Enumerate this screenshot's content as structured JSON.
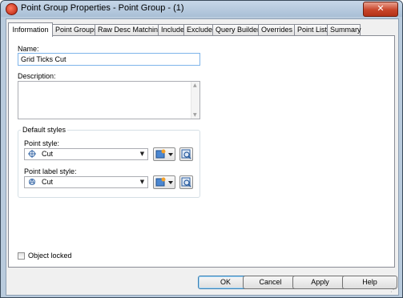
{
  "window": {
    "title": "Point Group Properties - Point Group - (1)",
    "close_glyph": "✕"
  },
  "tabs": [
    {
      "label": "Information",
      "active": true
    },
    {
      "label": "Point Groups"
    },
    {
      "label": "Raw Desc Matching"
    },
    {
      "label": "Include"
    },
    {
      "label": "Exclude"
    },
    {
      "label": "Query Builder"
    },
    {
      "label": "Overrides"
    },
    {
      "label": "Point List"
    },
    {
      "label": "Summary"
    }
  ],
  "info": {
    "name_label": "Name:",
    "name_value": "Grid Ticks Cut",
    "description_label": "Description:",
    "description_value": "",
    "default_styles_label": "Default styles",
    "point_style_label": "Point style:",
    "point_style_value": "Cut",
    "point_label_style_label": "Point label style:",
    "point_label_style_value": "Cut",
    "object_locked_label": "Object locked",
    "object_locked_checked": false
  },
  "buttons": {
    "ok": "OK",
    "cancel": "Cancel",
    "apply": "Apply",
    "help": "Help"
  },
  "icons": {
    "app": "autocad-civil-icon",
    "point_style": "point-style-icon",
    "point_label_style": "label-style-icon",
    "create_edit": "style-edit-icon",
    "preview": "style-preview-icon"
  }
}
